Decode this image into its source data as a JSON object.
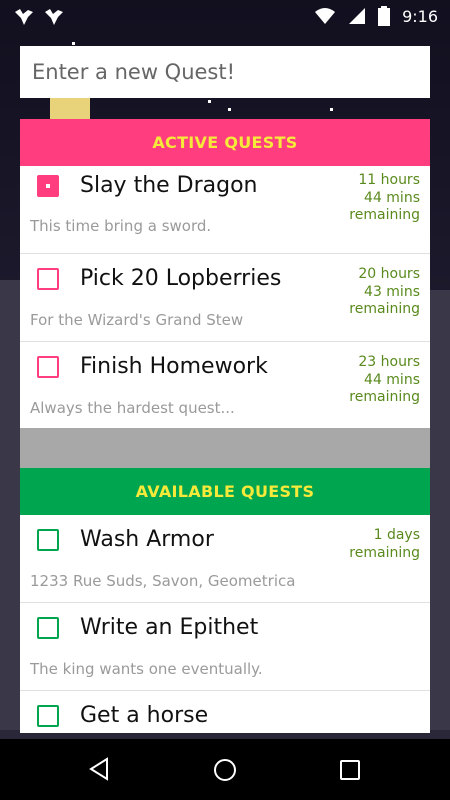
{
  "status": {
    "time": "9:16",
    "left_icons": [
      "bird-notification-icon",
      "bird-notification-icon"
    ],
    "right_icons": [
      "wifi-icon",
      "signal-icon",
      "battery-icon"
    ]
  },
  "input": {
    "placeholder": "Enter a new Quest!"
  },
  "active": {
    "header": "ACTIVE QUESTS",
    "items": [
      {
        "title": "Slay the Dragon",
        "subtitle": "This time bring a sword.",
        "time1": "11 hours",
        "time2": "44 mins",
        "time3": "remaining",
        "checked": true
      },
      {
        "title": "Pick 20 Lopberries",
        "subtitle": "For the Wizard's Grand Stew",
        "time1": "20 hours",
        "time2": "43 mins",
        "time3": "remaining",
        "checked": false
      },
      {
        "title": "Finish Homework",
        "subtitle": "Always the hardest quest...",
        "time1": "23 hours",
        "time2": "44 mins",
        "time3": "remaining",
        "checked": false
      }
    ]
  },
  "available": {
    "header": "AVAILABLE QUESTS",
    "items": [
      {
        "title": "Wash Armor",
        "subtitle": "1233 Rue Suds, Savon, Geometrica",
        "time1": "1 days",
        "time2": "remaining"
      },
      {
        "title": "Write an Epithet",
        "subtitle": "The king wants one eventually."
      },
      {
        "title": "Get a horse"
      }
    ]
  },
  "colors": {
    "active_accent": "#ff3d7f",
    "available_accent": "#00a550",
    "header_text": "#f5e93a",
    "time_text": "#5a8a1e"
  },
  "nav": {
    "icons": [
      "back-icon",
      "home-icon",
      "recents-icon"
    ]
  }
}
